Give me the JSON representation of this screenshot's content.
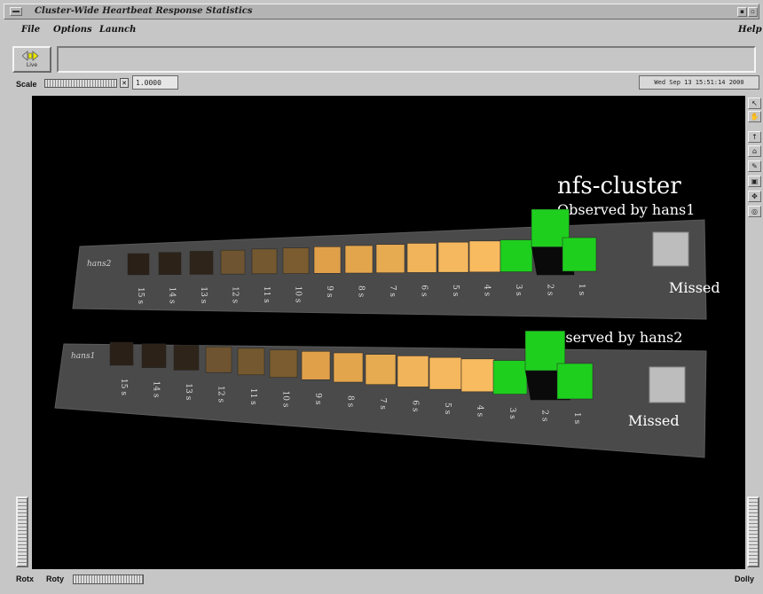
{
  "window": {
    "title": "Cluster-Wide Heartbeat Response Statistics",
    "min_btn": "▪",
    "max_btn": "▫"
  },
  "menubar": {
    "items": [
      "File",
      "Options",
      "Launch"
    ],
    "help": "Help"
  },
  "toolbar": {
    "live_label": "Live"
  },
  "scale": {
    "label": "Scale",
    "value": "1.0000",
    "x_btn": "✕"
  },
  "timestamp": "Wed Sep 13 15:51:14 2000",
  "scene": {
    "title": "nfs-cluster",
    "panels": [
      {
        "observed_by": "Observed by hans1",
        "host": "hans2",
        "missed_label": "Missed",
        "bins": [
          "15 s",
          "14 s",
          "13 s",
          "12 s",
          "11 s",
          "10 s",
          "9 s",
          "8 s",
          "7 s",
          "6 s",
          "5 s",
          "4 s",
          "3 s",
          "2 s",
          "1 s"
        ]
      },
      {
        "observed_by": "Observed by hans2",
        "host": "hans1",
        "missed_label": "Missed",
        "bins": [
          "15 s",
          "14 s",
          "13 s",
          "12 s",
          "11 s",
          "10 s",
          "9 s",
          "8 s",
          "7 s",
          "6 s",
          "5 s",
          "4 s",
          "3 s",
          "2 s",
          "1 s"
        ]
      }
    ],
    "colors": {
      "background": "#000000",
      "panel": "#4a4a4a",
      "green": "#1ecf1e",
      "missed": "#bdbdbd"
    }
  },
  "bottom": {
    "rotx": "Rotx",
    "roty": "Roty",
    "dolly": "Dolly"
  },
  "right_tools": [
    "↖",
    "✋",
    "↑",
    "⌂",
    "✎",
    "▣",
    "✥",
    "◎"
  ]
}
